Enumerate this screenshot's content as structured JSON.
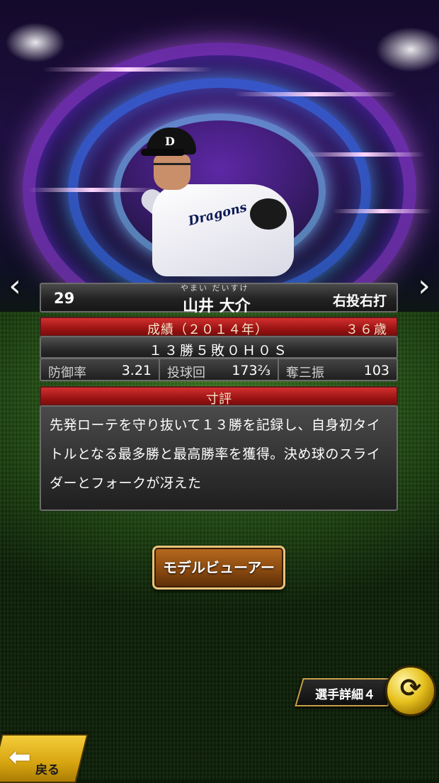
{
  "player": {
    "number": "29",
    "name_reading": "やまい だいすけ",
    "name": "山井 大介",
    "throw_bat": "右投右打",
    "cap_logo": "D",
    "jersey_text": "Dragons"
  },
  "record": {
    "title": "成績（２０１４年）",
    "age": "３６歳",
    "summary": "１３勝５敗０Ｈ０Ｓ",
    "stats": [
      {
        "label": "防御率",
        "value": "3.21"
      },
      {
        "label": "投球回",
        "value": "173⅔"
      },
      {
        "label": "奪三振",
        "value": "103"
      }
    ]
  },
  "evaluation": {
    "title": "寸評",
    "text": "先発ローテを守り抜いて１３勝を記録し、自身初タイトルとなる最多勝と最高勝率を獲得。決め球のスライダーとフォークが冴えた"
  },
  "buttons": {
    "model_viewer": "モデルビューアー",
    "player_detail": "選手詳細４",
    "back": "戻る"
  },
  "icons": {
    "prev": "‹",
    "next": "›",
    "switch": "⟳",
    "back_arrow": "⬅"
  },
  "colors": {
    "header_red": "#9c1414",
    "button_brown": "#8a4a10",
    "gold": "#e7c21e"
  }
}
